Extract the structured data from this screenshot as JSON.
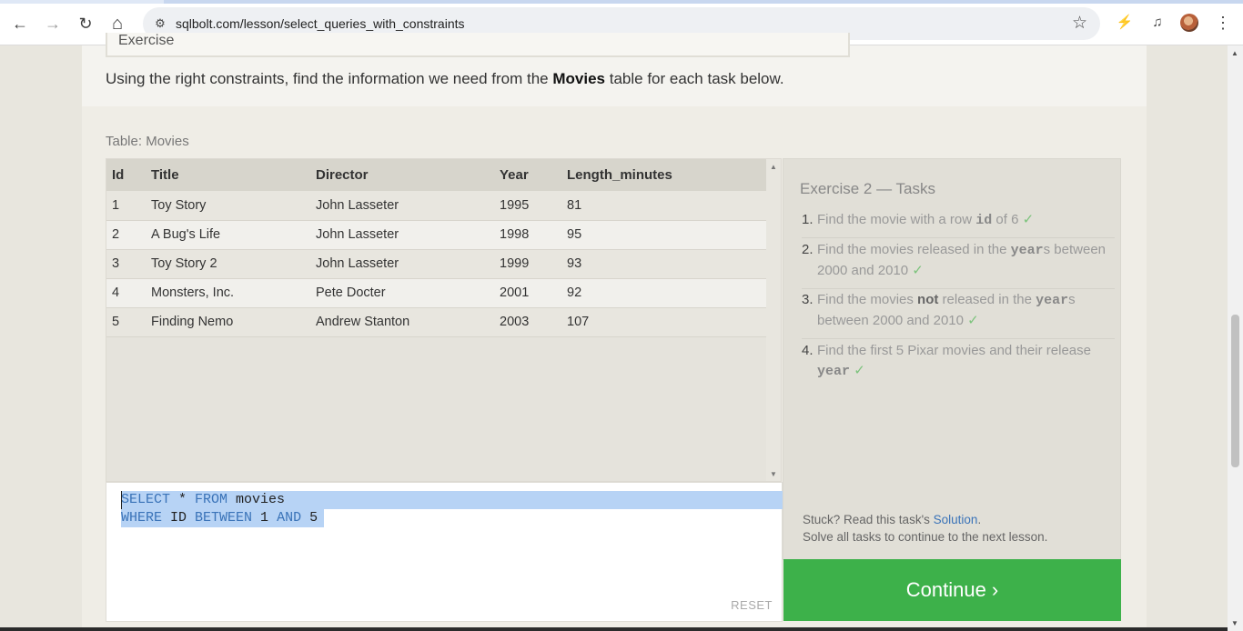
{
  "browser": {
    "url": "sqlbolt.com/lesson/select_queries_with_constraints",
    "back_icon": "←",
    "forward_icon": "→",
    "reload_icon": "↻",
    "home_icon": "⌂",
    "site_info_icon": "⚙",
    "star_icon": "☆",
    "ext1_icon": "⚡",
    "ext2_icon": "♫",
    "menu_icon": "⋮"
  },
  "lesson": {
    "exercise_header": "Exercise",
    "intro_pre": "Using the right constraints, find the information we need from the ",
    "intro_bold": "Movies",
    "intro_post": " table for each task below.",
    "table_label": "Table: Movies"
  },
  "table": {
    "columns": [
      "Id",
      "Title",
      "Director",
      "Year",
      "Length_minutes"
    ],
    "rows": [
      [
        "1",
        "Toy Story",
        "John Lasseter",
        "1995",
        "81"
      ],
      [
        "2",
        "A Bug's Life",
        "John Lasseter",
        "1998",
        "95"
      ],
      [
        "3",
        "Toy Story 2",
        "John Lasseter",
        "1999",
        "93"
      ],
      [
        "4",
        "Monsters, Inc.",
        "Pete Docter",
        "2001",
        "92"
      ],
      [
        "5",
        "Finding Nemo",
        "Andrew Stanton",
        "2003",
        "107"
      ]
    ]
  },
  "editor": {
    "line1": {
      "kw1": "SELECT",
      "mid": " * ",
      "kw2": "FROM",
      "rest": " movies"
    },
    "line2": {
      "kw1": "WHERE",
      "mid": " ID ",
      "kw2": "BETWEEN",
      "mid2": " 1 ",
      "kw3": "AND",
      "rest": " 5"
    },
    "reset_label": "RESET"
  },
  "tasks": {
    "title": "Exercise 2 — Tasks",
    "items": [
      {
        "num": "1.",
        "a": "Find the movie with a row ",
        "code": "id",
        "b": " of 6 ",
        "check": "✓"
      },
      {
        "num": "2.",
        "a": "Find the movies released in the ",
        "code": "year",
        "b": "s between 2000 and 2010 ",
        "check": "✓"
      },
      {
        "num": "3.",
        "a": "Find the movies ",
        "strong": "not",
        "a2": " released in the ",
        "code": "year",
        "b": "s between 2000 and 2010 ",
        "check": "✓"
      },
      {
        "num": "4.",
        "a": "Find the first 5 Pixar movies and their release ",
        "code": "year",
        "b": " ",
        "check": "✓"
      }
    ],
    "stuck_pre": "Stuck? Read this task's ",
    "stuck_link": "Solution",
    "stuck_post": ".",
    "solve_all": "Solve all tasks to continue to the next lesson."
  },
  "continue_label": "Continue ›",
  "colors": {
    "continue_bg": "#3db14a",
    "keyword": "#3a73b8",
    "selection": "#b7d3f5",
    "check": "#7cc37c"
  }
}
